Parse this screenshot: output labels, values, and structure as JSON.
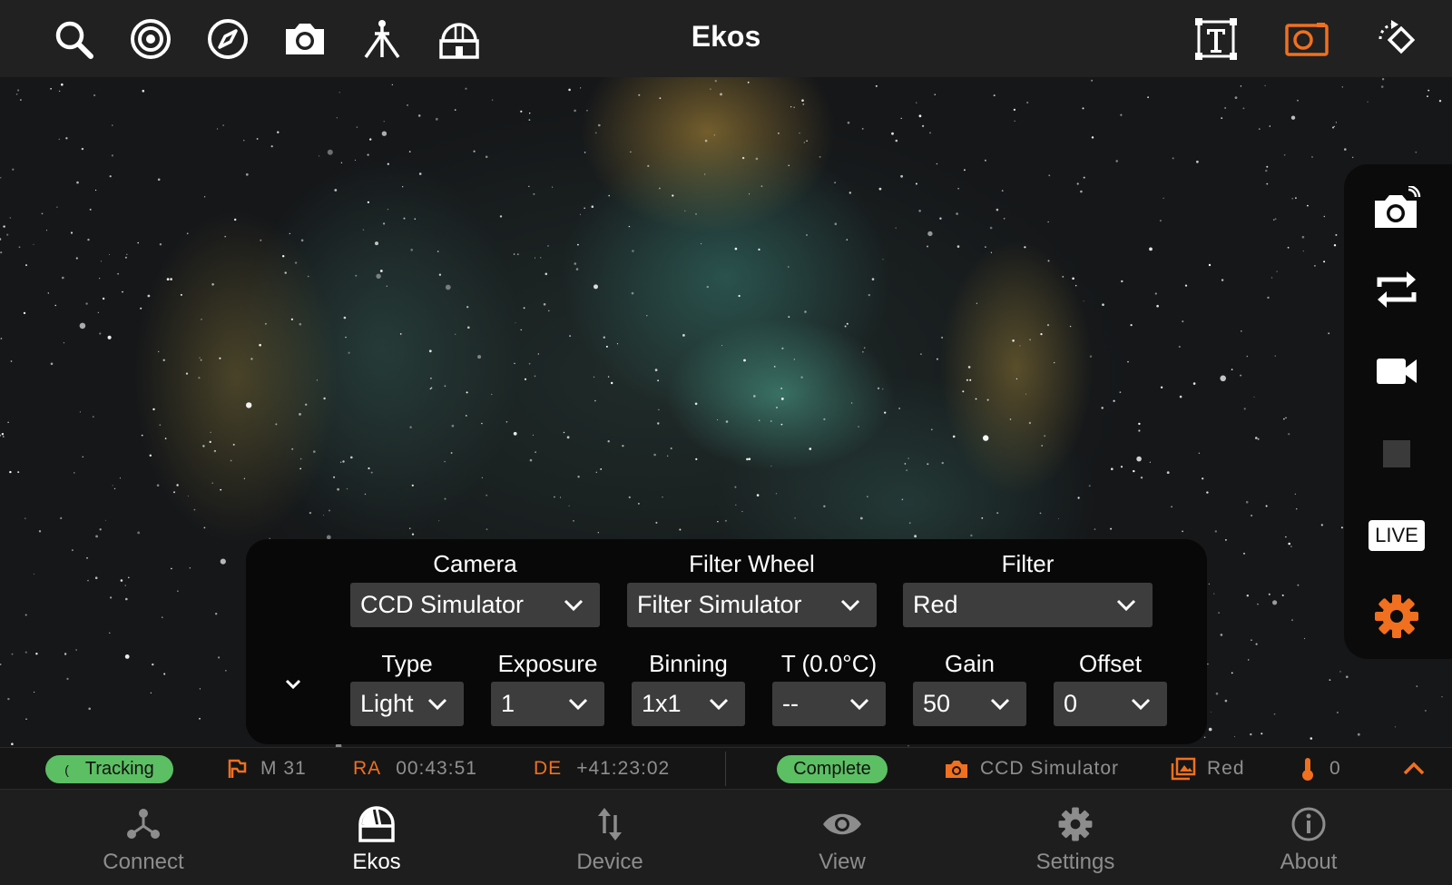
{
  "app": {
    "title": "Ekos"
  },
  "top_icons": [
    "search-icon",
    "target-icon",
    "compass-icon",
    "camera-icon",
    "tripod-icon",
    "observatory-icon",
    "text-frame-icon",
    "capture-frame-icon",
    "rotate-icon"
  ],
  "capture_panel": {
    "camera": {
      "label": "Camera",
      "value": "CCD Simulator"
    },
    "filter_wheel": {
      "label": "Filter Wheel",
      "value": "Filter Simulator"
    },
    "filter": {
      "label": "Filter",
      "value": "Red"
    },
    "type": {
      "label": "Type",
      "value": "Light"
    },
    "exposure": {
      "label": "Exposure",
      "value": "1"
    },
    "binning": {
      "label": "Binning",
      "value": "1x1"
    },
    "temperature": {
      "label": "T (0.0°C)",
      "value": "--"
    },
    "gain": {
      "label": "Gain",
      "value": "50"
    },
    "offset": {
      "label": "Offset",
      "value": "0"
    }
  },
  "right_toolbar": {
    "live_label": "LIVE",
    "items": [
      "capture-icon",
      "loop-icon",
      "video-icon",
      "stop-icon",
      "live-badge",
      "settings-gear-icon"
    ]
  },
  "status": {
    "mount_state": "Tracking",
    "target": "M 31",
    "ra_label": "RA",
    "ra_value": "00:43:51",
    "de_label": "DE",
    "de_value": "+41:23:02",
    "capture_state": "Complete",
    "camera_name": "CCD Simulator",
    "filter_name": "Red",
    "temperature_value": "0"
  },
  "bottom_nav": {
    "connect": "Connect",
    "ekos": "Ekos",
    "device": "Device",
    "view": "View",
    "settings": "Settings",
    "about": "About"
  },
  "colors": {
    "accent": "#f0701f",
    "status_green": "#5cbf63",
    "panel_bg": "#080808",
    "combo_bg": "#3d3d3d"
  }
}
